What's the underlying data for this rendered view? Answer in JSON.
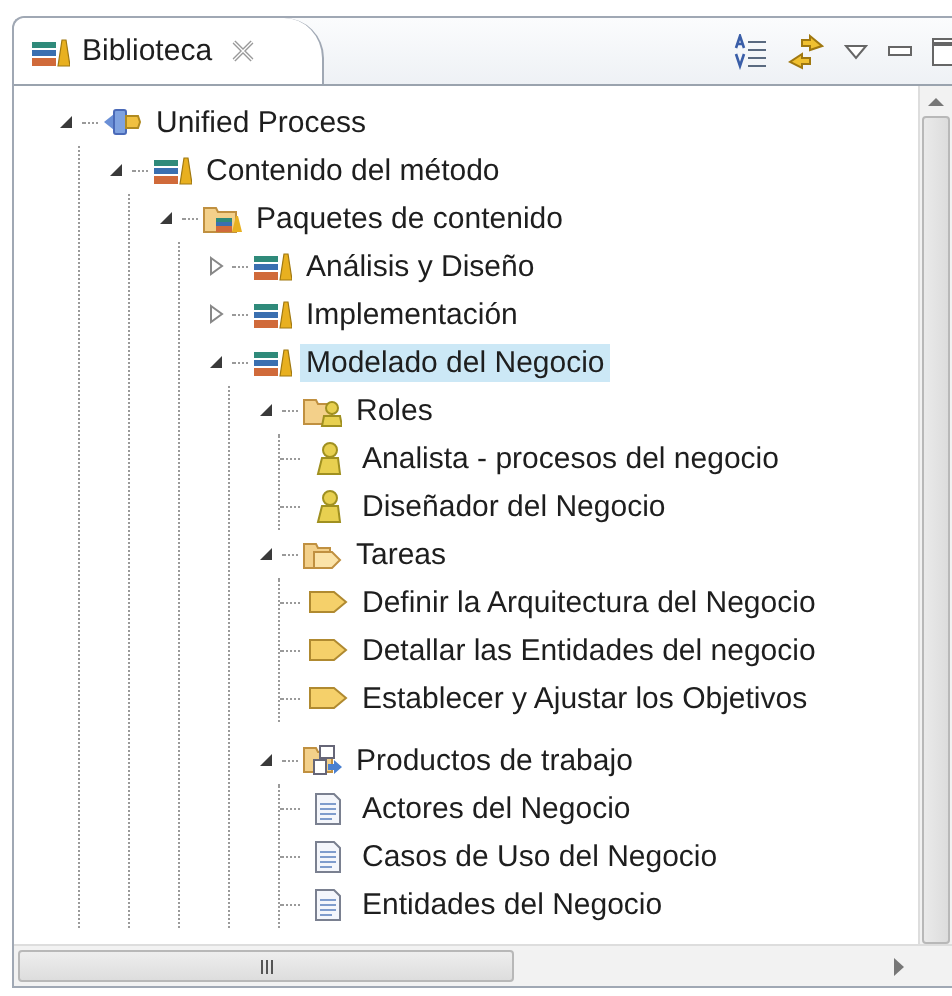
{
  "view": {
    "title": "Biblioteca"
  },
  "tree": [
    {
      "label": "Unified Process",
      "kind": "process",
      "expanded": true,
      "selected": false,
      "children": [
        {
          "label": "Contenido del método",
          "kind": "library",
          "expanded": true,
          "selected": false,
          "children": [
            {
              "label": "Paquetes de contenido",
              "kind": "packages",
              "expanded": true,
              "selected": false,
              "children": [
                {
                  "label": "Análisis y Diseño",
                  "kind": "library",
                  "expanded": false,
                  "selected": false
                },
                {
                  "label": "Implementación",
                  "kind": "library",
                  "expanded": false,
                  "selected": false
                },
                {
                  "label": "Modelado del Negocio",
                  "kind": "library",
                  "expanded": true,
                  "selected": true,
                  "children": [
                    {
                      "label": "Roles",
                      "kind": "roles",
                      "expanded": true,
                      "selected": false,
                      "children": [
                        {
                          "label": "Analista - procesos del negocio",
                          "kind": "role",
                          "selected": false
                        },
                        {
                          "label": "Diseñador del Negocio",
                          "kind": "role",
                          "selected": false
                        }
                      ]
                    },
                    {
                      "label": "Tareas",
                      "kind": "tasks",
                      "expanded": true,
                      "selected": false,
                      "children": [
                        {
                          "label": "Definir la Arquitectura del Negocio",
                          "kind": "task",
                          "selected": false
                        },
                        {
                          "label": "Detallar las Entidades del negocio",
                          "kind": "task",
                          "selected": false
                        },
                        {
                          "label": "Establecer y Ajustar los Objetivos",
                          "kind": "task",
                          "selected": false
                        }
                      ]
                    },
                    {
                      "label": "Productos de trabajo",
                      "kind": "workproducts",
                      "expanded": true,
                      "selected": false,
                      "children": [
                        {
                          "label": "Actores del Negocio",
                          "kind": "artifact",
                          "selected": false
                        },
                        {
                          "label": "Casos de Uso del Negocio",
                          "kind": "artifact",
                          "selected": false
                        },
                        {
                          "label": "Entidades del Negocio",
                          "kind": "artifact",
                          "selected": false
                        }
                      ]
                    }
                  ]
                }
              ]
            }
          ]
        }
      ]
    }
  ]
}
